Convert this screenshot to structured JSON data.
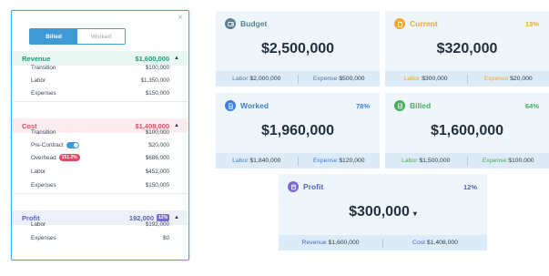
{
  "panel": {
    "close_glyph": "×",
    "toggle": {
      "billed": "Billed",
      "worked": "Worked"
    },
    "revenue": {
      "label": "Revenue",
      "amount": "$1,600,000",
      "rows": [
        {
          "label": "Transition",
          "value": "$100,000"
        },
        {
          "label": "Labor",
          "value": "$1,350,000"
        },
        {
          "label": "Expenses",
          "value": "$150,000"
        }
      ]
    },
    "cost": {
      "label": "Cost",
      "amount": "$1,408,000",
      "rows": [
        {
          "label": "Transition",
          "value": "$100,000"
        },
        {
          "label": "Pre-Contract",
          "value": "$20,000"
        },
        {
          "label": "Overhead",
          "badge": "151.2%",
          "value": "$686,000"
        },
        {
          "label": "Labor",
          "value": "$452,000"
        },
        {
          "label": "Expenses",
          "value": "$150,000"
        }
      ]
    },
    "profit": {
      "label": "Profit",
      "amount": "192,000",
      "badge": "12%",
      "rows": [
        {
          "label": "Labor",
          "value": "$192,000"
        },
        {
          "label": "Expenses",
          "value": "$0"
        }
      ]
    }
  },
  "cards": {
    "budget": {
      "title": "Budget",
      "amount": "$2,500,000",
      "left_label": "Labor",
      "left_value": "$2,000,000",
      "right_label": "Expense",
      "right_value": "$500,000"
    },
    "current": {
      "title": "Current",
      "pct": "13%",
      "amount": "$320,000",
      "left_label": "Labor",
      "left_value": "$300,000",
      "right_label": "Expense",
      "right_value": "$20,000"
    },
    "worked": {
      "title": "Worked",
      "pct": "78%",
      "amount": "$1,960,000",
      "left_label": "Labor",
      "left_value": "$1,840,000",
      "right_label": "Expense",
      "right_value": "$120,000"
    },
    "billed": {
      "title": "Billed",
      "pct": "64%",
      "amount": "$1,600,000",
      "left_label": "Labor",
      "left_value": "$1,500,000",
      "right_label": "Expense",
      "right_value": "$100,000"
    },
    "profit": {
      "title": "Profit",
      "pct": "12%",
      "amount": "$300,000",
      "left_label": "Revenue",
      "left_value": "$1,600,000",
      "right_label": "Cost",
      "right_value": "$1,408,000"
    }
  },
  "colors": {
    "revenue": "#17a07a",
    "cost": "#e14b68",
    "profit": "#5264c6",
    "budget": "#5a7f93",
    "current": "#f0a830",
    "worked": "#3f7fd9",
    "billed": "#48ad5c",
    "toggle": "#3f9ad6"
  },
  "icons": {
    "budget": "wallet-icon",
    "current": "clipboard-icon",
    "worked": "document-icon",
    "billed": "check-document-icon",
    "profit": "calculator-icon"
  }
}
